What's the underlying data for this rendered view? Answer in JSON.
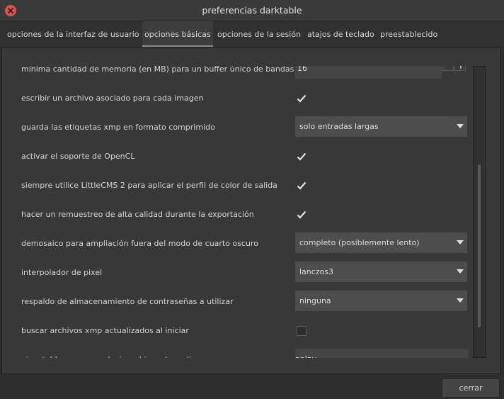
{
  "window": {
    "title": "preferencias darktable",
    "close_icon": "close-icon",
    "close_color": "#d9534f"
  },
  "tabs": [
    {
      "label": "opciones de la interfaz de usuario"
    },
    {
      "label": "opciones básicas",
      "active": true
    },
    {
      "label": "opciones de la sesión"
    },
    {
      "label": "atajos de teclado"
    },
    {
      "label": "preestablecido"
    }
  ],
  "settings": {
    "memory": {
      "label": "mínima cantidad de memoria (en MB) para un buffer único de bandas",
      "value": "16",
      "minus_icon": "minus-icon",
      "plus_icon": "plus-icon"
    },
    "sidecar": {
      "label": "escribir un archivo asociado para cada imagen",
      "checked": true
    },
    "xmp_compress": {
      "label": "guarda las etiquetas xmp en formato comprimido",
      "value": "solo entradas largas"
    },
    "opencl": {
      "label": "activar el soporte de OpenCL",
      "checked": true
    },
    "littlecms": {
      "label": "siempre utilice LittleCMS 2 para aplicar el perfil de color de salida",
      "checked": true
    },
    "hq_resample": {
      "label": "hacer un remuestreo de alta calidad durante la exportación",
      "checked": true
    },
    "demosaic": {
      "label": "demosaico para ampliación fuera del modo de cuarto oscuro",
      "value": "completo (posiblemente lento)"
    },
    "interpolator": {
      "label": "interpolador de pixel",
      "value": "lanczos3"
    },
    "password": {
      "label": "respaldo de almacenamiento de contraseñas a utilizar",
      "value": "ninguna"
    },
    "xmp_search": {
      "label": "buscar archivos xmp actualizados al iniciar",
      "checked": false
    },
    "audio": {
      "label": "ejecutable para reproducir archivos de audio",
      "value": "aplay"
    }
  },
  "footer": {
    "close_label": "cerrar"
  },
  "colors": {
    "background": "#2e2e2e",
    "panel": "#383838",
    "combo": "#4d4d4d"
  }
}
